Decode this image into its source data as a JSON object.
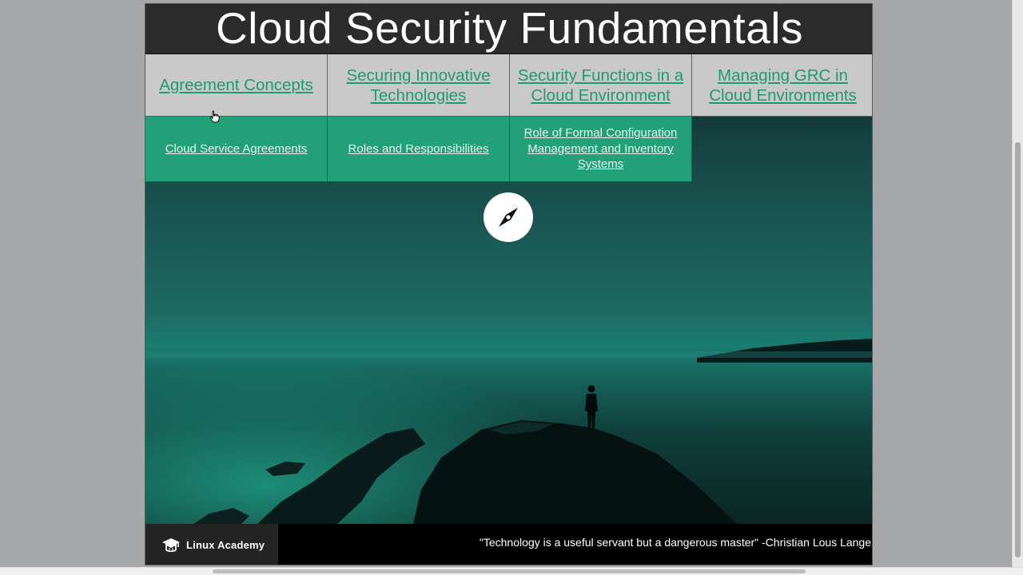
{
  "slide": {
    "title": "Cloud Security Fundamentals"
  },
  "nav": {
    "top": [
      {
        "label": "Agreement Concepts"
      },
      {
        "label": "Securing Innovative Technologies"
      },
      {
        "label": "Security Functions in a Cloud Environment"
      },
      {
        "label": "Managing GRC in Cloud Environments"
      }
    ],
    "sub": [
      {
        "label": "Cloud Service Agreements"
      },
      {
        "label": "Roles and Responsibilities"
      },
      {
        "label": "Role of Formal Configuration Management and Inventory Systems"
      }
    ]
  },
  "center_icon": "compass-icon",
  "footer": {
    "brand": "Linux Academy",
    "brand_icon": "graduation-cap-icon",
    "quote": "\"Technology is a useful servant but a dangerous master\" -Christian Lous Lange"
  },
  "colors": {
    "accent_green": "#22a078",
    "link_green": "#209a75",
    "title_bar": "#2b2b2b",
    "nav_gray": "#c9c9c9"
  }
}
